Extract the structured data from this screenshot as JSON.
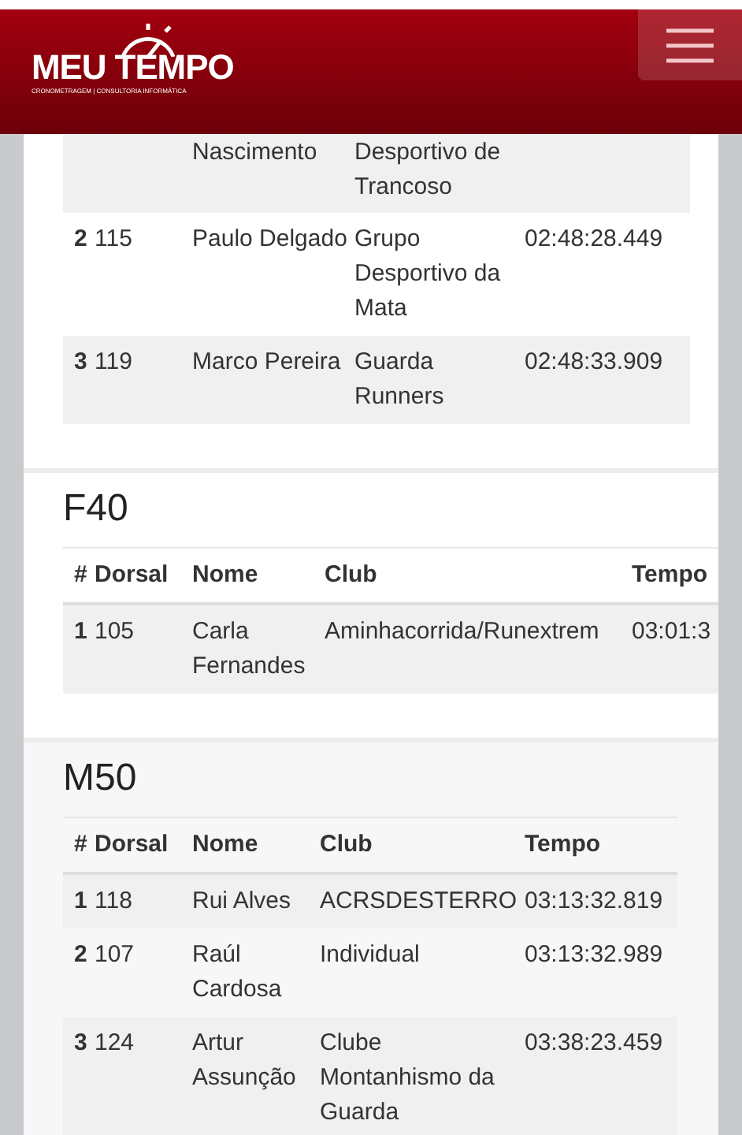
{
  "header": {
    "logo_title": "MEU TEMPO",
    "logo_tagline": "CRONOMETRAGEM | CONSULTORIA INFORMÁTICA"
  },
  "sections": [
    {
      "rows": [
        {
          "name": "Nascimento",
          "club": "Desportivo de Trancoso"
        },
        {
          "rank": "2",
          "bib": "115",
          "name": "Paulo Delgado",
          "club": "Grupo Desportivo da Mata",
          "time": "02:48:28.449"
        },
        {
          "rank": "3",
          "bib": "119",
          "name": "Marco Pereira",
          "club": "Guarda Runners",
          "time": "02:48:33.909"
        }
      ]
    },
    {
      "title": "F40",
      "columns": [
        "#",
        "Dorsal",
        "Nome",
        "Club",
        "Tempo"
      ],
      "rows": [
        {
          "rank": "1",
          "bib": "105",
          "name": "Carla Fernandes",
          "club": "Aminhacorrida/Runextrem",
          "time": "03:01:3"
        }
      ]
    },
    {
      "title": "M50",
      "columns": [
        "#",
        "Dorsal",
        "Nome",
        "Club",
        "Tempo"
      ],
      "rows": [
        {
          "rank": "1",
          "bib": "118",
          "name": "Rui Alves",
          "club": "ACRSDESTERRO",
          "time": "03:13:32.819"
        },
        {
          "rank": "2",
          "bib": "107",
          "name": "Raúl Cardosa",
          "club": "Individual",
          "time": "03:13:32.989"
        },
        {
          "rank": "3",
          "bib": "124",
          "name": "Artur Assunção",
          "club": "Clube Montanhismo da Guarda",
          "time": "03:38:23.459"
        }
      ]
    }
  ]
}
